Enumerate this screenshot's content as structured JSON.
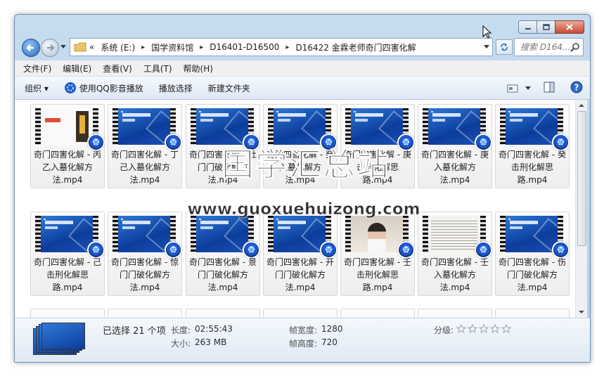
{
  "window": {
    "controls": {
      "minimize": "minimize",
      "maximize": "maximize",
      "close": "close"
    }
  },
  "address": {
    "prefix": "«",
    "crumbs": [
      "系统 (E:)",
      "国学资料馆",
      "D16401-D16500",
      "D16422 金霖老师奇门四害化解"
    ],
    "separator": "▸"
  },
  "search": {
    "placeholder": "搜索 D164..."
  },
  "menu": [
    "文件(F)",
    "编辑(E)",
    "查看(V)",
    "工具(T)",
    "帮助(H)"
  ],
  "toolbar": {
    "organize": "组织 ▾",
    "play_qq": "使用QQ影音播放",
    "play_selection": "播放选择",
    "new_folder": "新建文件夹"
  },
  "files": [
    {
      "name": "奇门四害化解 - 丙乙入墓化解方法.mp4",
      "thumb": "pic"
    },
    {
      "name": "奇门四害化解 - 丁己入墓化解方法.mp4",
      "thumb": "blue"
    },
    {
      "name": "奇门四害化解 - 杜门门破化解方法.mp4",
      "thumb": "blue"
    },
    {
      "name": "奇门四害化解 - 癸入墓化解方法.mp4",
      "thumb": "blue"
    },
    {
      "name": "奇门四害化解 - 庚击刑化解思路.mp4",
      "thumb": "blue"
    },
    {
      "name": "奇门四害化解 - 庚入墓化解方法.mp4",
      "thumb": "blue"
    },
    {
      "name": "奇门四害化解 - 癸击刑化解思路.mp4",
      "thumb": "blue"
    },
    {
      "name": "奇门四害化解 - 己击刑化解思路.mp4",
      "thumb": "blue"
    },
    {
      "name": "奇门四害化解 - 惊门门破化解方法.mp4",
      "thumb": "blue"
    },
    {
      "name": "奇门四害化解 - 景门门破化解方法.mp4",
      "thumb": "blue"
    },
    {
      "name": "奇门四害化解 - 开门门破化解方法.mp4",
      "thumb": "blue"
    },
    {
      "name": "奇门四害化解 - 壬击刑化解思路.mp4",
      "thumb": "room"
    },
    {
      "name": "奇门四害化解 - 壬入墓化解方法.mp4",
      "thumb": "light"
    },
    {
      "name": "奇门四害化解 - 伤门门破化解方法.mp4",
      "thumb": "blue"
    }
  ],
  "watermark": {
    "big": "国学汇总站",
    "url": "www.guoxuehuizong.com"
  },
  "details": {
    "selected": "已选择 21 个项",
    "length_label": "长度:",
    "length": "02:55:43",
    "size_label": "大小:",
    "size": "263 MB",
    "width_label": "帧宽度:",
    "width": "1280",
    "height_label": "帧高度:",
    "height": "720",
    "rating_label": "分级:",
    "rating": 0
  },
  "colors": {
    "accent": "#2a6cbf",
    "thumb_blue": "#1a4fb4"
  }
}
